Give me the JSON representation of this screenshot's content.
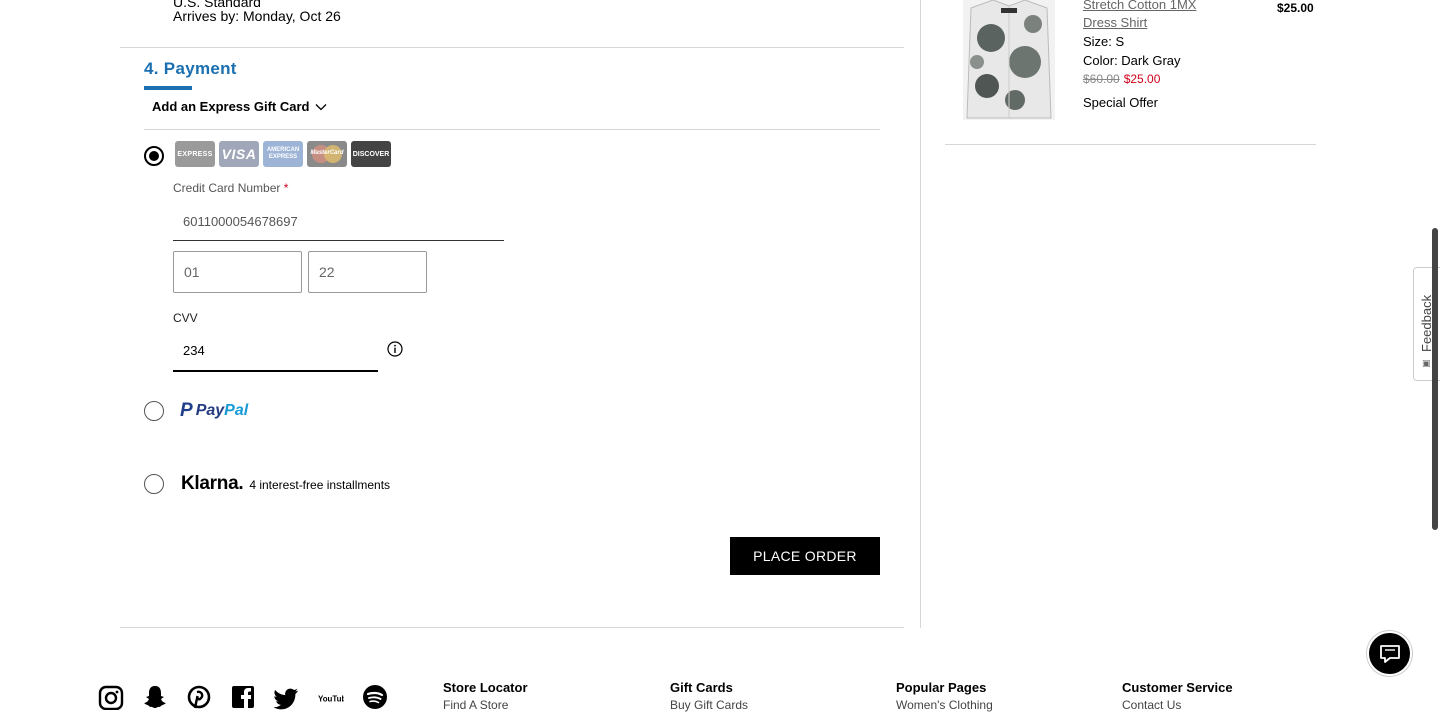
{
  "shipping": {
    "method": "U.S. Standard",
    "arrives": "Arrives by: Monday, Oct 26"
  },
  "payment": {
    "title": "4. Payment",
    "gift_card_toggle": "Add an Express Gift Card",
    "card_logos": {
      "express": "EXPRESS",
      "visa": "VISA",
      "amex": "AMERICAN EXPRESS",
      "mastercard": "MasterCard",
      "discover": "DISCOVER"
    },
    "cc_label": "Credit Card Number",
    "required_mark": "*",
    "cc_number": "6011000054678697",
    "exp_month": "01",
    "exp_year": "22",
    "cvv_label": "CVV",
    "cvv_value": "234",
    "paypal": {
      "pay": "Pay",
      "pal": "Pal"
    },
    "klarna": {
      "logo": "Klarna.",
      "text": "4 interest-free installments"
    },
    "place_order": "PLACE ORDER"
  },
  "order_summary": {
    "item": {
      "name": "Stretch Cotton 1MX Dress Shirt",
      "price": "$25.00",
      "size": "Size: S",
      "color": "Color: Dark Gray",
      "original_price": "$60.00",
      "sale_price": "$25.00",
      "offer": "Special Offer"
    }
  },
  "feedback": "Feedback",
  "footer": {
    "social": [
      "instagram-icon",
      "snapchat-icon",
      "pinterest-icon",
      "facebook-icon",
      "twitter-icon",
      "youtube-icon",
      "spotify-icon"
    ],
    "youtube_text": "YouTube",
    "columns": [
      {
        "title": "Store Locator",
        "sub": "Find A Store"
      },
      {
        "title": "Gift Cards",
        "sub": "Buy Gift Cards"
      },
      {
        "title": "Popular Pages",
        "sub": "Women's Clothing"
      },
      {
        "title": "Customer Service",
        "sub": "Contact Us"
      }
    ]
  },
  "colors": {
    "accent": "#1a6fb0",
    "sale": "#d0021b",
    "paypal_dark": "#253b80",
    "paypal_light": "#179bd7"
  }
}
